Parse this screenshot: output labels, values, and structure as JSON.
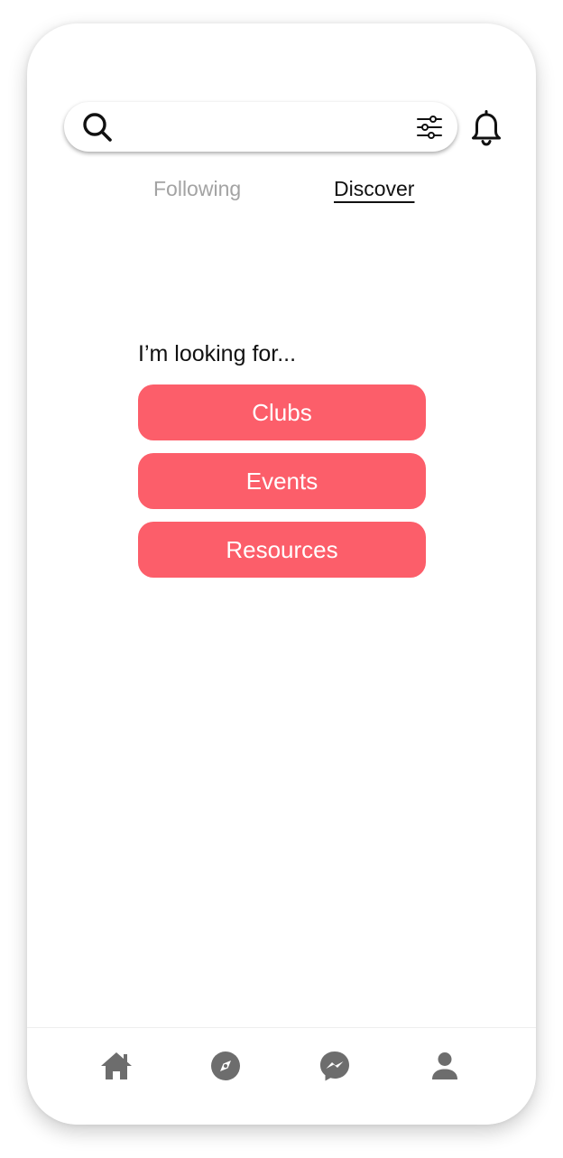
{
  "search": {
    "value": "",
    "search_icon": "search-icon",
    "filter_icon": "sliders-icon"
  },
  "header": {
    "notification_icon": "bell-icon"
  },
  "tabs": [
    {
      "label": "Following",
      "active": false
    },
    {
      "label": "Discover",
      "active": true
    }
  ],
  "main": {
    "prompt": "I’m looking for...",
    "options": [
      {
        "label": "Clubs"
      },
      {
        "label": "Events"
      },
      {
        "label": "Resources"
      }
    ]
  },
  "bottom_nav": [
    {
      "icon": "home-icon"
    },
    {
      "icon": "compass-icon"
    },
    {
      "icon": "messenger-icon"
    },
    {
      "icon": "profile-icon"
    }
  ],
  "colors": {
    "accent": "#fc5e6a",
    "tab_inactive": "#a3a3a3",
    "text": "#111111",
    "nav_icon": "#6d6d6d"
  }
}
